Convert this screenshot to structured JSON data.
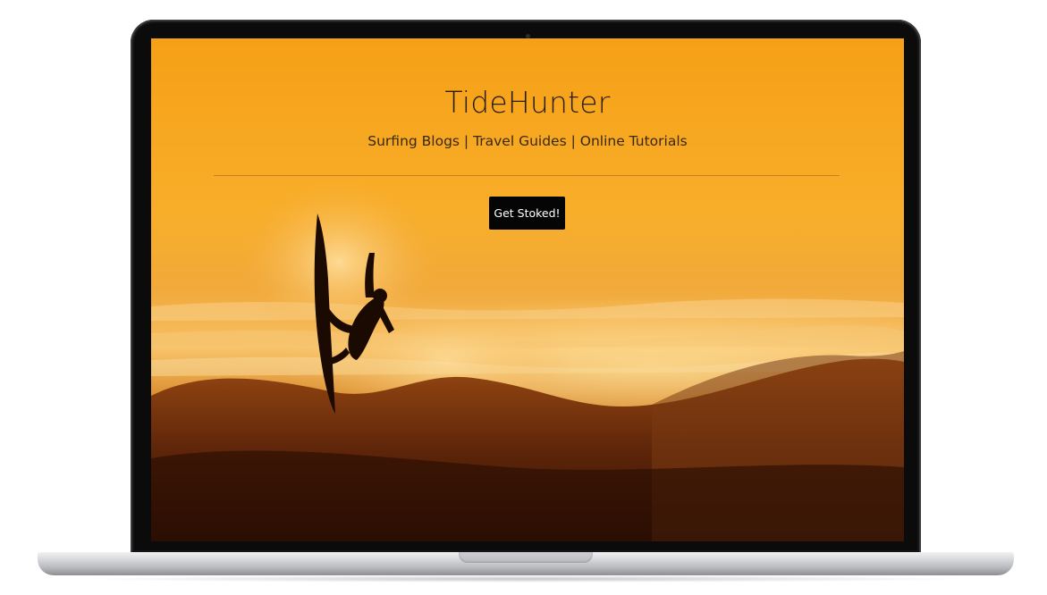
{
  "site": {
    "title": "TideHunter",
    "tagline": "Surfing Blogs | Travel Guides | Online Tutorials",
    "cta_label": "Get Stoked!"
  },
  "colors": {
    "sky": "#f5a623",
    "sky_top": "#f7a21b",
    "horizon": "#f3b24a",
    "wave_dark": "#5a2308",
    "button_bg": "#050505",
    "button_text": "#ffffff",
    "device_bezel": "#0b0b0c"
  },
  "icons": {
    "hero_image": "surfer-silhouette-sunset"
  }
}
